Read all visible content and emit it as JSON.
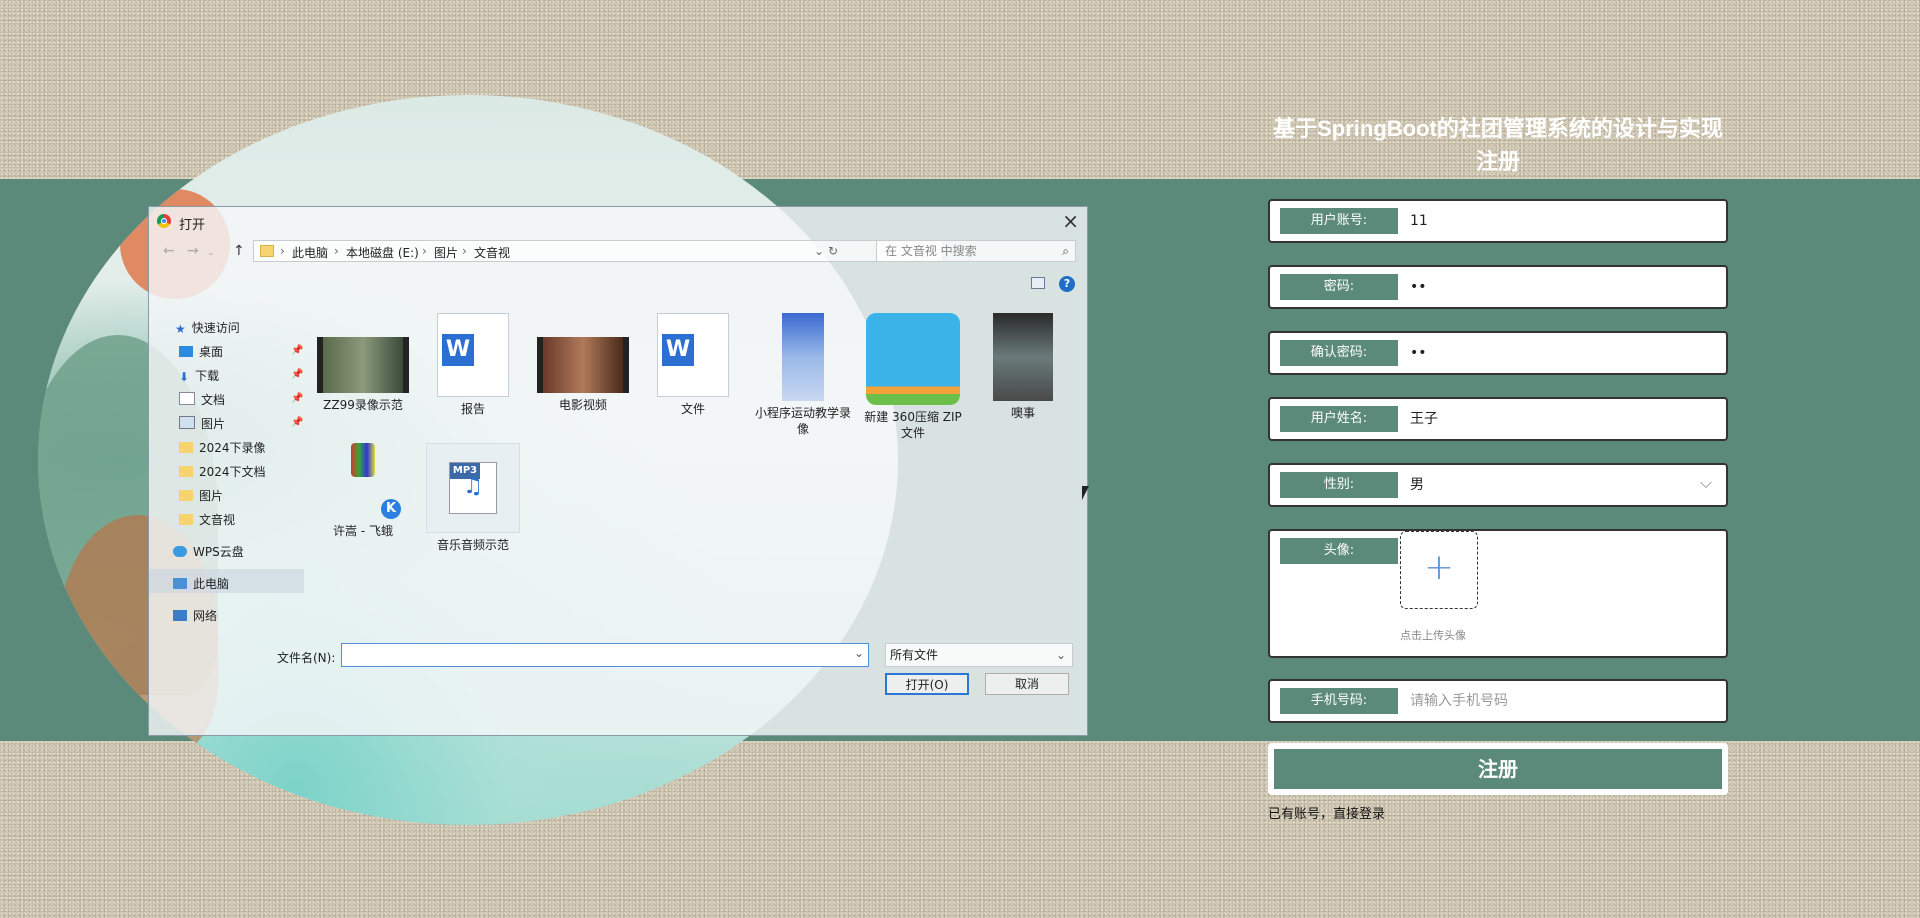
{
  "page": {
    "title_line1": "基于SpringBoot的社团管理系统的设计与实现",
    "title_line2": "注册"
  },
  "form": {
    "account": {
      "label": "用户账号:",
      "value": "11"
    },
    "password": {
      "label": "密码:",
      "value": "••",
      "required_mark": "*"
    },
    "confirm_password": {
      "label": "确认密码:",
      "value": "••",
      "required_mark": "*"
    },
    "name": {
      "label": "用户姓名:",
      "value": "王子",
      "required_mark": "*"
    },
    "gender": {
      "label": "性别:",
      "value": "男"
    },
    "avatar": {
      "label": "头像:",
      "upload_icon": "+",
      "upload_text": "点击上传头像"
    },
    "phone": {
      "label": "手机号码:",
      "placeholder": "请输入手机号码"
    },
    "submit_label": "注册",
    "login_link": "已有账号，直接登录"
  },
  "dialog": {
    "title": "打开",
    "close": "×",
    "breadcrumb": [
      "此电脑",
      "本地磁盘 (E:)",
      "图片",
      "文音视"
    ],
    "search_placeholder": "在 文音视 中搜索",
    "help": "?",
    "sidebar": [
      {
        "label": "快速访问",
        "icon": "star-icon"
      },
      {
        "label": "桌面",
        "icon": "desktop-icon",
        "pinned": true
      },
      {
        "label": "下载",
        "icon": "download-icon",
        "pinned": true
      },
      {
        "label": "文档",
        "icon": "document-icon",
        "pinned": true
      },
      {
        "label": "图片",
        "icon": "picture-icon",
        "pinned": true
      },
      {
        "label": "2024下录像",
        "icon": "folder-icon"
      },
      {
        "label": "2024下文档",
        "icon": "folder-icon"
      },
      {
        "label": "图片",
        "icon": "folder-icon"
      },
      {
        "label": "文音视",
        "icon": "folder-icon"
      },
      {
        "label": "WPS云盘",
        "icon": "cloud-icon"
      },
      {
        "label": "此电脑",
        "icon": "computer-icon"
      },
      {
        "label": "网络",
        "icon": "network-icon"
      }
    ],
    "files": [
      {
        "name": "ZZ99录像示范",
        "kind": "video"
      },
      {
        "name": "报告",
        "kind": "word"
      },
      {
        "name": "电影视频",
        "kind": "video"
      },
      {
        "name": "文件",
        "kind": "word"
      },
      {
        "name": "小程序运动教学录像",
        "kind": "video"
      },
      {
        "name": "新建 360压缩 ZIP 文件",
        "kind": "zip"
      },
      {
        "name": "噢事",
        "kind": "video"
      },
      {
        "name": "许嵩 - 飞蛾",
        "kind": "audio-app"
      },
      {
        "name": "音乐音频示范",
        "kind": "mp3"
      }
    ],
    "filename_label": "文件名(N):",
    "filename_value": "",
    "filetype": "所有文件",
    "open_label": "打开(O)",
    "cancel_label": "取消"
  },
  "colors": {
    "accent": "#5c8a7a",
    "required": "#e0302c",
    "upload_plus": "#5b8fd6"
  }
}
